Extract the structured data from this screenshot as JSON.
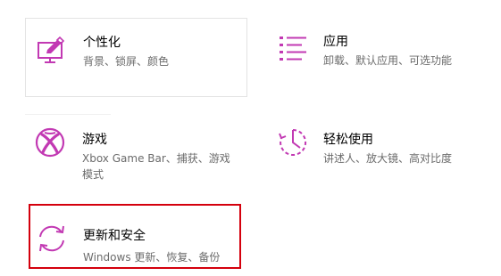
{
  "accent_color": "#c239b3",
  "highlight_color": "#d4000d",
  "tiles": {
    "personalization": {
      "title": "个性化",
      "desc": "背景、锁屏、颜色",
      "icon": "personalization-icon"
    },
    "apps": {
      "title": "应用",
      "desc": "卸载、默认应用、可选功能",
      "icon": "apps-list-icon"
    },
    "gaming": {
      "title": "游戏",
      "desc": "Xbox Game Bar、捕获、游戏模式",
      "icon": "xbox-icon"
    },
    "ease": {
      "title": "轻松使用",
      "desc": "讲述人、放大镜、高对比度",
      "icon": "ease-of-access-icon"
    },
    "update": {
      "title": "更新和安全",
      "desc": "Windows 更新、恢复、备份",
      "icon": "sync-icon"
    }
  }
}
